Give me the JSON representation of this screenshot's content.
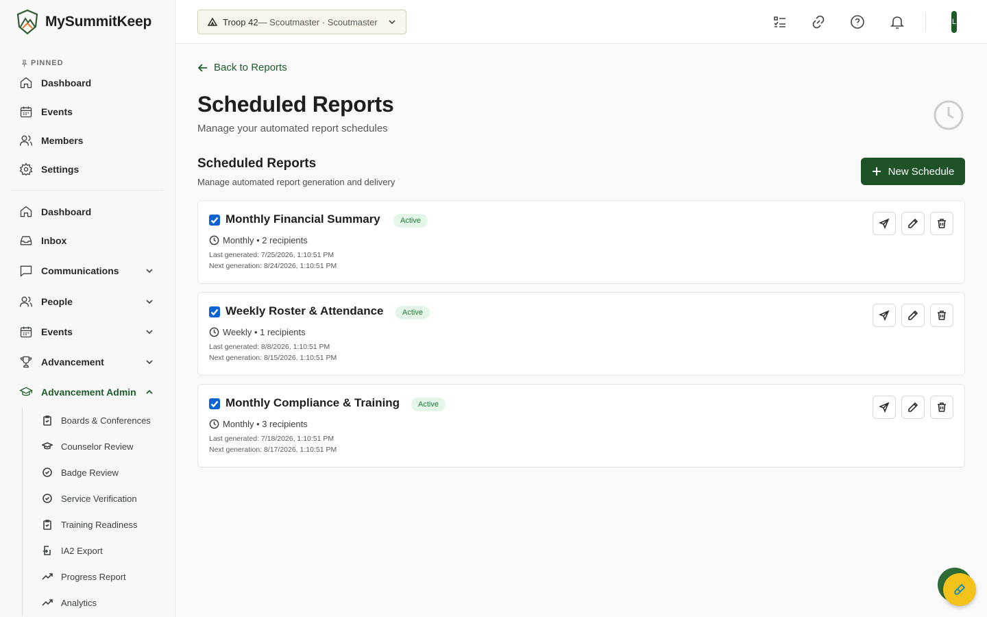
{
  "app": {
    "name": "MySummitKeep"
  },
  "sidebar": {
    "pinned_label": "PINNED",
    "pinned": [
      {
        "label": "Dashboard",
        "icon": "home-icon"
      },
      {
        "label": "Events",
        "icon": "calendar-icon"
      },
      {
        "label": "Members",
        "icon": "users-icon"
      },
      {
        "label": "Settings",
        "icon": "gear-icon"
      }
    ],
    "main": [
      {
        "label": "Dashboard",
        "icon": "home-icon"
      },
      {
        "label": "Inbox",
        "icon": "inbox-icon"
      },
      {
        "label": "Communications",
        "icon": "message-icon"
      },
      {
        "label": "People",
        "icon": "users-icon"
      },
      {
        "label": "Events",
        "icon": "calendar-icon"
      },
      {
        "label": "Advancement",
        "icon": "trophy-icon"
      },
      {
        "label": "Advancement Admin",
        "icon": "graduation-cap-icon"
      }
    ],
    "admin_items": [
      {
        "label": "Boards & Conferences",
        "icon": "clipboard-icon"
      },
      {
        "label": "Counselor Review",
        "icon": "graduation-cap-icon"
      },
      {
        "label": "Badge Review",
        "icon": "check-circle-icon"
      },
      {
        "label": "Service Verification",
        "icon": "check-circle-icon"
      },
      {
        "label": "Training Readiness",
        "icon": "clipboard-icon"
      },
      {
        "label": "IA2 Export",
        "icon": "export-icon"
      },
      {
        "label": "Progress Report",
        "icon": "trending-up-icon"
      },
      {
        "label": "Analytics",
        "icon": "trending-up-icon"
      }
    ]
  },
  "topbar": {
    "troop": "Troop 42",
    "troop_role": " — Scoutmaster · Scoutmaster",
    "avatar_initial": "L"
  },
  "page": {
    "back_label": "Back to Reports",
    "title": "Scheduled Reports",
    "subtitle": "Manage your automated report schedules",
    "section_title": "Scheduled Reports",
    "section_subtitle": "Manage automated report generation and delivery",
    "new_button": "New Schedule"
  },
  "reports": [
    {
      "name": "Monthly Financial Summary",
      "status": "Active",
      "frequency": "Monthly • 2 recipients",
      "last": "Last generated: 7/25/2026, 1:10:51 PM",
      "next": "Next generation: 8/24/2026, 1:10:51 PM"
    },
    {
      "name": "Weekly Roster & Attendance",
      "status": "Active",
      "frequency": "Weekly • 1 recipients",
      "last": "Last generated: 8/8/2026, 1:10:51 PM",
      "next": "Next generation: 8/15/2026, 1:10:51 PM"
    },
    {
      "name": "Monthly Compliance & Training",
      "status": "Active",
      "frequency": "Monthly • 3 recipients",
      "last": "Last generated: 7/18/2026, 1:10:51 PM",
      "next": "Next generation: 8/17/2026, 1:10:51 PM"
    }
  ],
  "colors": {
    "brand": "#1e5227",
    "active_badge_bg": "#e3f6e7",
    "active_badge_text": "#1f7a39",
    "checkbox": "#0b63d6"
  }
}
